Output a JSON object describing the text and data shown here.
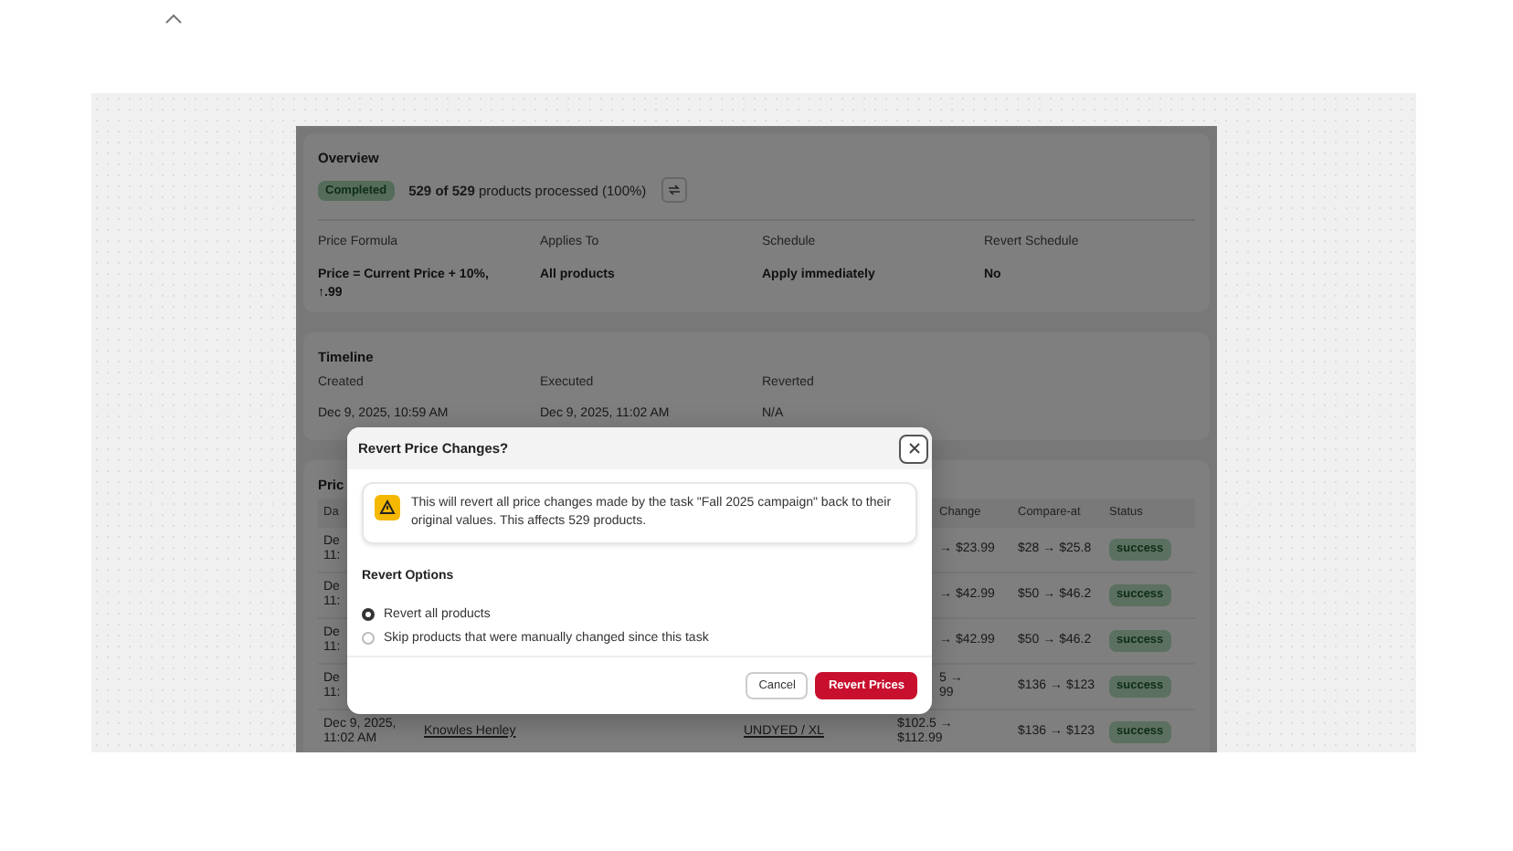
{
  "overview": {
    "title": "Overview",
    "status_badge": "Completed",
    "progress_text": "**529 of 529** products processed (100%)",
    "fields": [
      {
        "label": "Price Formula",
        "value": "Price = Current Price + 10%, ↑.99"
      },
      {
        "label": "Applies To",
        "value": "All products"
      },
      {
        "label": "Schedule",
        "value": "Apply immediately"
      },
      {
        "label": "Revert Schedule",
        "value": "No"
      }
    ]
  },
  "timeline": {
    "title": "Timeline",
    "fields": [
      {
        "label": "Created",
        "value": "Dec 9, 2025, 10:59 AM"
      },
      {
        "label": "Executed",
        "value": "Dec 9, 2025, 11:02 AM"
      },
      {
        "label": "Reverted",
        "value": "N/A"
      }
    ]
  },
  "prices": {
    "title": "Pric",
    "columns": [
      "Da",
      "",
      "",
      "Change",
      "Compare-at",
      "Status"
    ],
    "rows": [
      {
        "date": [
          "De",
          "11:"
        ],
        "price_change": [
          "→ $23.99"
        ],
        "compare_at": "$28 → $25.8",
        "status": "success"
      },
      {
        "date": [
          "De",
          "11:"
        ],
        "price_change": [
          "→ $42.99"
        ],
        "compare_at": "$50 → $46.2",
        "status": "success"
      },
      {
        "date": [
          "De",
          "11:"
        ],
        "price_change": [
          "→ $42.99"
        ],
        "compare_at": "$50 → $46.2",
        "status": "success"
      },
      {
        "date": [
          "De",
          "11:"
        ],
        "price_change": [
          "5 →",
          "99"
        ],
        "compare_at": "$136 → $123",
        "status": "success"
      },
      {
        "date": [
          "Dec 9, 2025,",
          "11:02 AM"
        ],
        "product": "Knowles Henley",
        "variant": "UNDYED / XL",
        "price_change": [
          "$102.5 →",
          "$112.99"
        ],
        "compare_at": "$136 → $123",
        "status": "success"
      }
    ]
  },
  "dialog": {
    "title": "Revert Price Changes?",
    "warning": "This will revert all price changes made by the task \"Fall 2025 campaign\" back to their original values. This affects 529 products.",
    "options_title": "Revert Options",
    "options": [
      {
        "label": "Revert all products",
        "selected": true
      },
      {
        "label": "Skip products that were manually changed since this task",
        "selected": false
      }
    ],
    "buttons": [
      {
        "label": "Cancel",
        "kind": "secondary"
      },
      {
        "label": "Revert Prices",
        "kind": "primary"
      }
    ]
  }
}
